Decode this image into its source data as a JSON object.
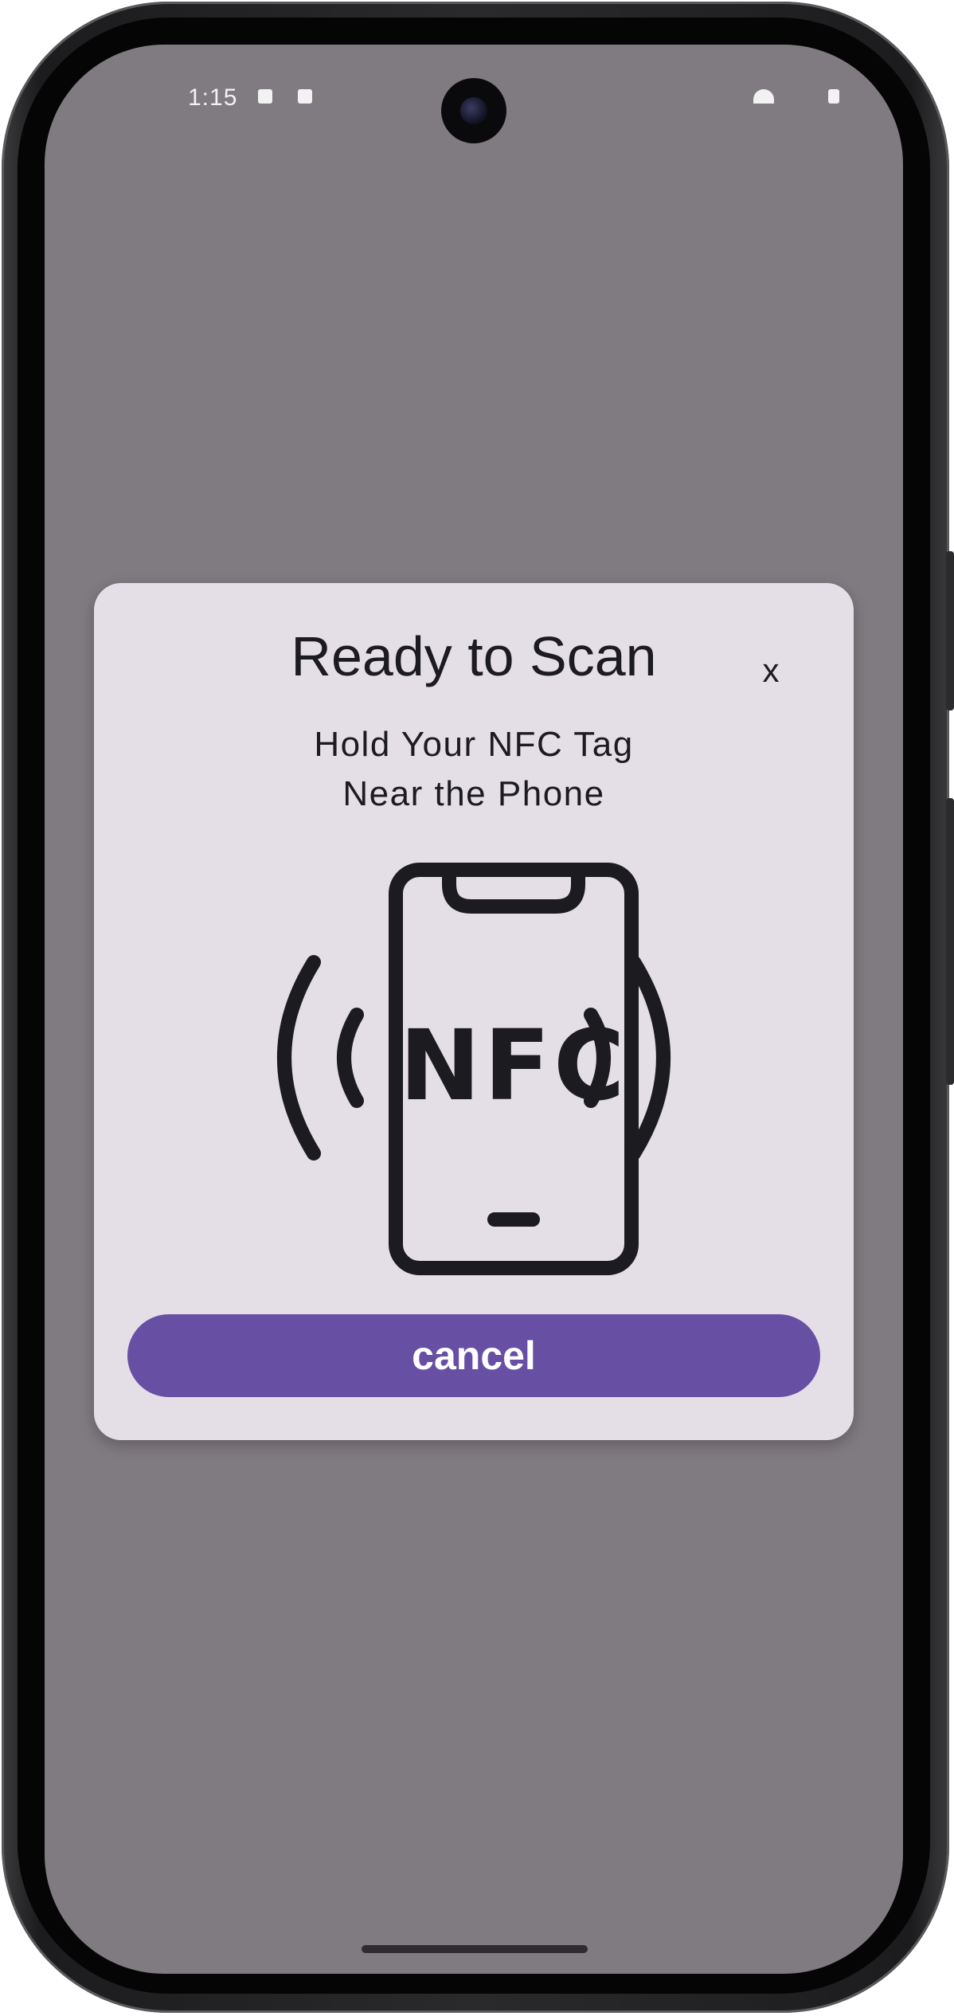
{
  "status_bar": {
    "time": "1:15"
  },
  "dialog": {
    "title": "Ready to Scan",
    "close_label": "x",
    "subtitle_line1": "Hold Your NFC Tag",
    "subtitle_line2": "Near the Phone",
    "illustration_text": "NFC",
    "cancel_label": "cancel"
  },
  "colors": {
    "scrim": "#807b80",
    "dialog_bg": "#e4dfe6",
    "primary": "#6750a4",
    "on_surface": "#1c1b1f"
  },
  "icons": {
    "illustration": "nfc-phone-icon",
    "camera": "front-camera"
  }
}
